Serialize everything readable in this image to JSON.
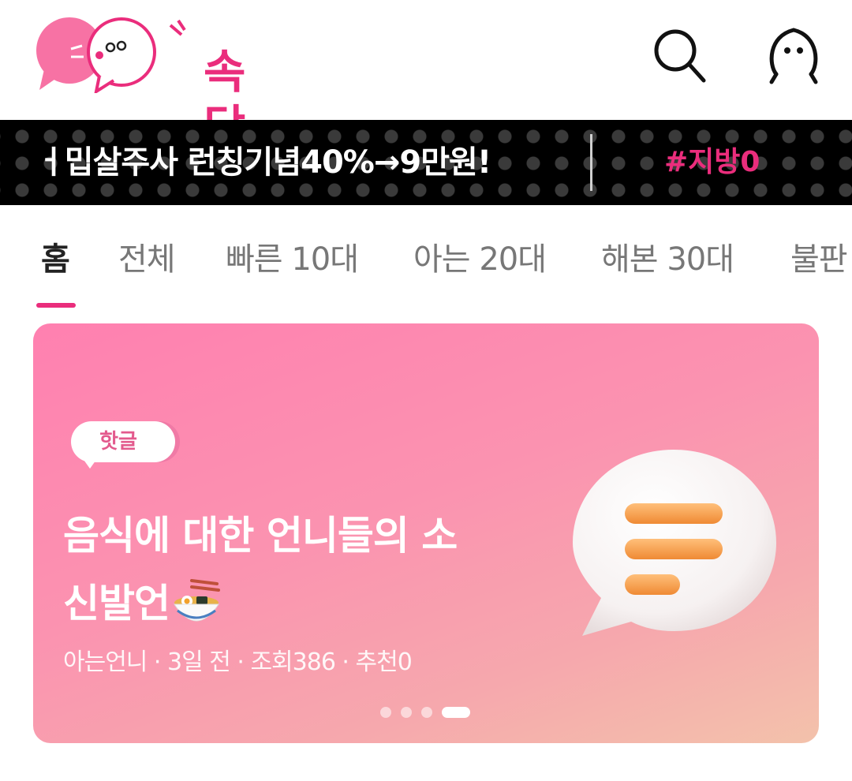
{
  "header": {
    "logo_text": "속닥",
    "search_icon": "search-icon",
    "profile_icon": "profile-icon"
  },
  "ticker": {
    "text": "ㅓ밉살주사 런칭기념40%→9만원!",
    "tag": "#지방0"
  },
  "tabs": [
    {
      "label": "홈",
      "active": true
    },
    {
      "label": "전체"
    },
    {
      "label": "빠른 10대"
    },
    {
      "label": "아는 20대"
    },
    {
      "label": "해본 30대"
    },
    {
      "label": "불판"
    }
  ],
  "banner": {
    "badge": "핫글",
    "title_line1": "음식에 대한 언니들의 소",
    "title_line2": "신발언",
    "title_emoji": "ramen-bowl-emoji",
    "meta": "아는언니 · 3일 전 · 조회386 · 추천0",
    "illustration": "chat-bubble-icon",
    "pagination": {
      "total": 4,
      "current": 4
    }
  },
  "colors": {
    "brand": "#ea2d7c",
    "ticker_bg": "#000000",
    "banner_start": "#ff80b0",
    "banner_end": "#f3c2ab",
    "bubble_lines": "#f39a45"
  }
}
